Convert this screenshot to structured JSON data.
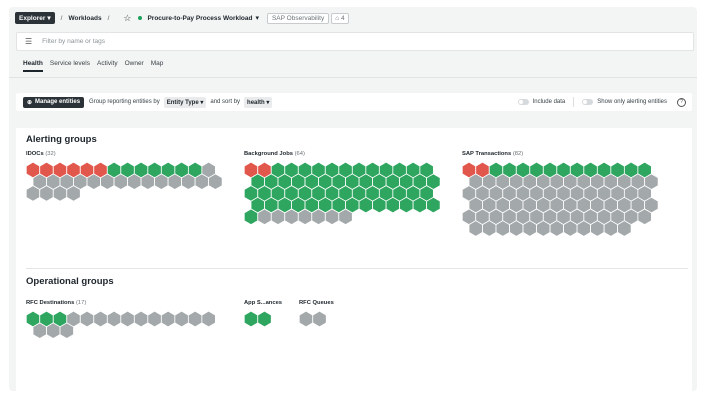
{
  "topbar": {
    "explorer_label": "Explorer",
    "crumb_workloads": "Workloads",
    "workload_name": "Procure-to-Pay Process Workload",
    "tag_label": "SAP Observability",
    "tag_count": "4"
  },
  "filter": {
    "placeholder": "Filter by name or tags"
  },
  "tabs": [
    "Health",
    "Service levels",
    "Activity",
    "Owner",
    "Map"
  ],
  "toolbar": {
    "manage_label": "Manage entities",
    "group_text": "Group reporting entities by",
    "group_value": "Entity Type",
    "sort_text": "and sort by",
    "sort_value": "health",
    "include_label": "Include data",
    "only_alerting_label": "Show only alerting entities"
  },
  "alerting": {
    "title": "Alerting groups",
    "groups": [
      {
        "name": "IDOCs",
        "count": "(32)",
        "red": 6,
        "green": 7,
        "gray": 19
      },
      {
        "name": "Background Jobs",
        "count": "(64)",
        "red": 2,
        "green": 55,
        "gray": 7
      },
      {
        "name": "SAP Transactions",
        "count": "(82)",
        "red": 2,
        "green": 12,
        "gray": 68
      }
    ]
  },
  "operational": {
    "title": "Operational groups",
    "groups": [
      {
        "name": "RFC Destinations",
        "count": "(17)",
        "red": 0,
        "green": 3,
        "gray": 14
      },
      {
        "name": "App S...ances",
        "count": "",
        "red": 0,
        "green": 2,
        "gray": 0
      },
      {
        "name": "RFC Queues",
        "count": "",
        "red": 0,
        "green": 0,
        "gray": 2
      }
    ]
  },
  "colors": {
    "red": "#e2574c",
    "green": "#2ea660",
    "gray": "#a3a8ab"
  }
}
